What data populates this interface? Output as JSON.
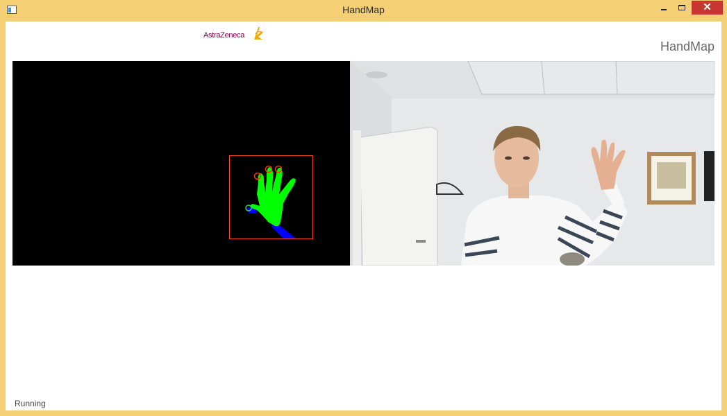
{
  "window": {
    "title": "HandMap",
    "controls": {
      "minimize": "minimize",
      "maximize": "maximize",
      "close": "✕"
    }
  },
  "header": {
    "logo_text": "AstraZeneca",
    "title": "HandMap"
  },
  "status": {
    "text": "Running"
  },
  "colors": {
    "titlebar": "#f4cf73",
    "close_button": "#c7372f",
    "logo": "#83004f",
    "hand_mask": "#00ff00",
    "arm_mask": "#0000ff",
    "bounding_box": "#ff3300"
  },
  "icons": {
    "app": "window-app-icon",
    "logo_mark": "astrazeneca-symbol"
  }
}
